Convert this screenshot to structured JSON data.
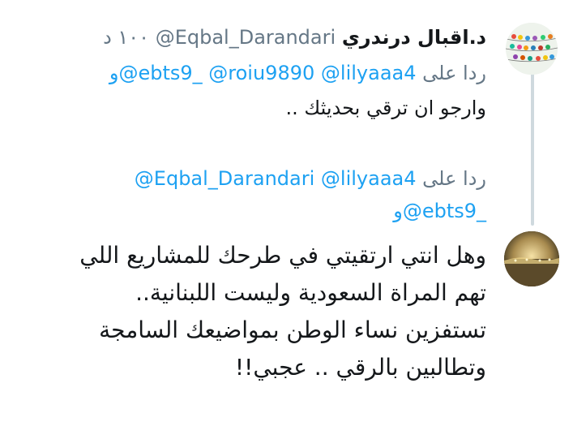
{
  "tweet1": {
    "author_name": "د.اقبال درندري",
    "handle": "@Eqbal_Darandari",
    "timestamp": "١٠٠ د",
    "reply_prefix": "ردا على",
    "reply_mentions": [
      "@lilyaaa4",
      "@roiu9890"
    ],
    "reply_connector": "و",
    "reply_last_mention": "@ebts9_",
    "text": "وارجو ان ترقي بحديثك .."
  },
  "tweet2": {
    "reply_prefix": "ردا على",
    "reply_mentions": [
      "@lilyaaa4",
      "@Eqbal_Darandari"
    ],
    "reply_connector": "و",
    "reply_last_mention": "@ebts9_",
    "text_lines": [
      "وهل انتي ارتقيتي في طرحك للمشاريع اللي",
      "تهم المراة السعودية وليست اللبنانية..",
      "تستفزين نساء الوطن بمواضيعك السامجة",
      "وتطالبين بالرقي .. عجبي!!"
    ]
  },
  "icons": {
    "avatar_top": "birds-on-wire-avatar",
    "avatar_bottom": "desert-landscape-avatar"
  },
  "colors": {
    "link": "#1da1f2",
    "secondary_text": "#657786",
    "thread_line": "#cfd9de"
  }
}
